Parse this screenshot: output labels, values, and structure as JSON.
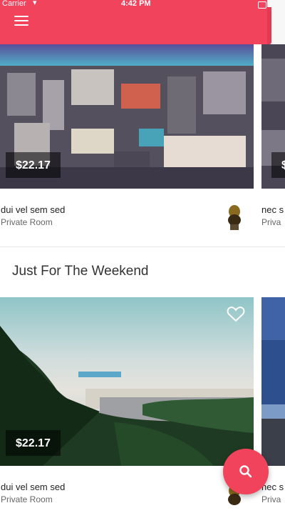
{
  "status_bar": {
    "carrier": "Carrier",
    "time": "4:42 PM"
  },
  "featured": {
    "cards": [
      {
        "price": "$22.17",
        "title": "dui vel sem sed",
        "subtitle": "Private Room"
      },
      {
        "price": "$",
        "title": "nec s",
        "subtitle": "Priva"
      }
    ]
  },
  "weekend": {
    "section_title": "Just For The Weekend",
    "cards": [
      {
        "price": "$22.17",
        "title": "dui vel sem sed",
        "subtitle": "Private Room"
      },
      {
        "title": "nec s",
        "subtitle": "Priva"
      }
    ]
  },
  "colors": {
    "accent": "#f1435b"
  },
  "icons": {
    "menu": "hamburger-icon",
    "favorite": "heart-icon",
    "search": "search-icon"
  }
}
